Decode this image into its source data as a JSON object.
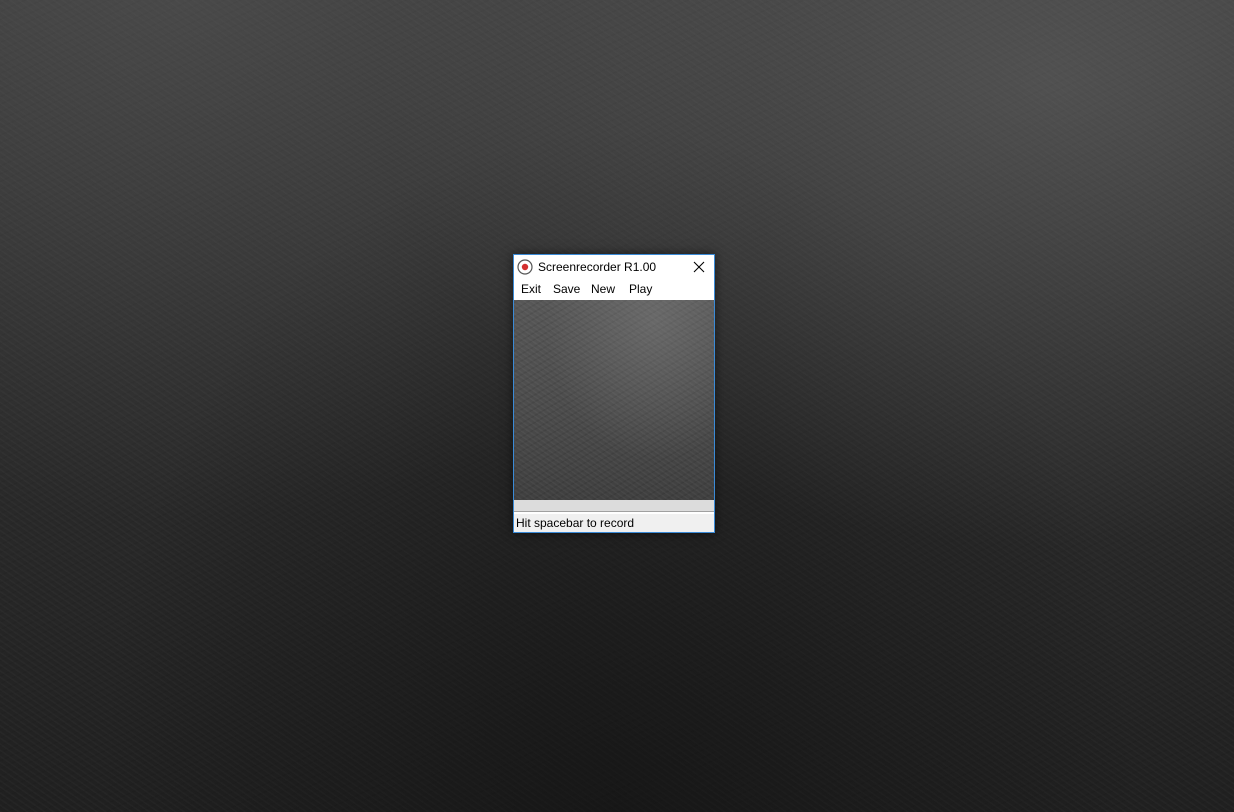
{
  "window": {
    "title": "Screenrecorder R1.00",
    "icon": "record-icon",
    "close_icon": "close-icon"
  },
  "menu": {
    "exit": "Exit",
    "save": "Save",
    "new": "New",
    "play": "Play"
  },
  "status": {
    "text": "Hit spacebar to record"
  },
  "colors": {
    "window_border": "#3a8ad6",
    "record_dot": "#d32f2f",
    "statusbar_bg": "#f0f0f0"
  }
}
